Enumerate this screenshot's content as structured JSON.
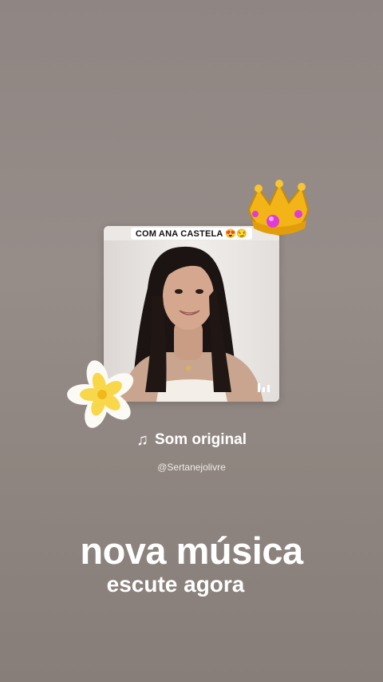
{
  "music_sticker": {
    "video_caption": "COM ANA CASTELA 😍😏",
    "song_title": "Som original",
    "song_handle": "@Sertanejolivre",
    "note_icon": "music-note-icon",
    "bars_icon": "audio-bars-icon"
  },
  "stickers": {
    "crown": "crown-emoji",
    "flower": "plumeria-flower"
  },
  "text_overlay": {
    "headline": "nova música",
    "subheadline": "escute agora"
  },
  "colors": {
    "background": "#918784",
    "text": "#ffffff",
    "crown_gold": "#f2b416",
    "gem_pink": "#e03bd6"
  }
}
